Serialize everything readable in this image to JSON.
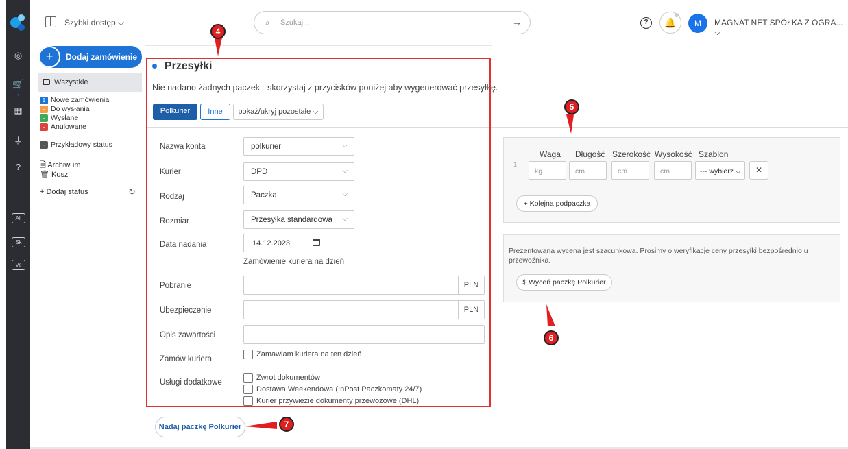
{
  "topbar": {
    "quick_access": "Szybki dostęp ⌵",
    "search_placeholder": "Szukaj...",
    "search_arrow": "→",
    "help": "?",
    "bell": "🔔",
    "avatar": "M",
    "company": "MAGNAT NET SPÓŁKA Z OGRA... ⌵"
  },
  "rail": {
    "pills": [
      "All",
      "Sk",
      "Ve"
    ]
  },
  "sidebar": {
    "add_order": "Dodaj zamówienie",
    "add_icon": "+",
    "all": "Wszystkie",
    "statuses": [
      {
        "label": "Nowe zamówienia",
        "badge": "1",
        "color": "#1e74d6"
      },
      {
        "label": "Do wysłania",
        "badge": "-",
        "color": "#f39c4a"
      },
      {
        "label": "Wysłane",
        "badge": "-",
        "color": "#3daa5c"
      },
      {
        "label": "Anulowane",
        "badge": "-",
        "color": "#d9443d"
      },
      {
        "label": "Przykładowy status",
        "badge": "-",
        "color": "#555555"
      }
    ],
    "archive": "Archiwum",
    "trash": "Kosz",
    "add_status": "+ Dodaj status"
  },
  "shipments": {
    "title": "Przesyłki",
    "no_packages": "Nie nadano żadnych paczek - skorzystaj z przycisków poniżej aby wygenerować przesyłkę.",
    "tabs": [
      "Polkurier",
      "Inne",
      "pokaż/ukryj pozostałe ⌵"
    ]
  },
  "form": {
    "account_label": "Nazwa konta",
    "account_value": "polkurier",
    "courier_label": "Kurier",
    "courier_value": "DPD",
    "type_label": "Rodzaj",
    "type_value": "Paczka",
    "size_label": "Rozmiar",
    "size_value": "Przesyłka standardowa",
    "date_label": "Data nadania",
    "date_value": "14.12.2023",
    "date_hint": "Zamówienie kuriera na dzień",
    "cod_label": "Pobranie",
    "insurance_label": "Ubezpieczenie",
    "currency": "PLN",
    "contents_label": "Opis zawartości",
    "order_courier_label": "Zamów kuriera",
    "order_courier_cb": "Zamawiam kuriera na ten dzień",
    "extra_label": "Usługi dodatkowe",
    "extras": [
      "Zwrot dokumentów",
      "Dostawa Weekendowa (InPost Paczkomaty 24/7)",
      "Kurier przywiezie dokumenty przewozowe (DHL)"
    ],
    "chevron": "⌵"
  },
  "send_button": "Nadaj paczkę Polkurier",
  "dims": {
    "headers": [
      "Waga",
      "Długość",
      "Szerokość",
      "Wysokość",
      "Szablon"
    ],
    "row_no": "1",
    "placeholders": [
      "kg",
      "cm",
      "cm",
      "cm"
    ],
    "template": "--- wybierz ⌵",
    "remove": "✕",
    "add_sub": "+ Kolejna podpaczka"
  },
  "pricing": {
    "info": "Prezentowana wycena jest szacunkowa. Prosimy o weryfikacje ceny przesyłki bezpośrednio u przewoźnika.",
    "button": "$ Wyceń paczkę Polkurier"
  },
  "annotations": [
    "4",
    "5",
    "6",
    "7"
  ],
  "colors": {
    "accent": "#1e74d6",
    "annotation": "#e02020",
    "rail": "#2b2d33"
  }
}
